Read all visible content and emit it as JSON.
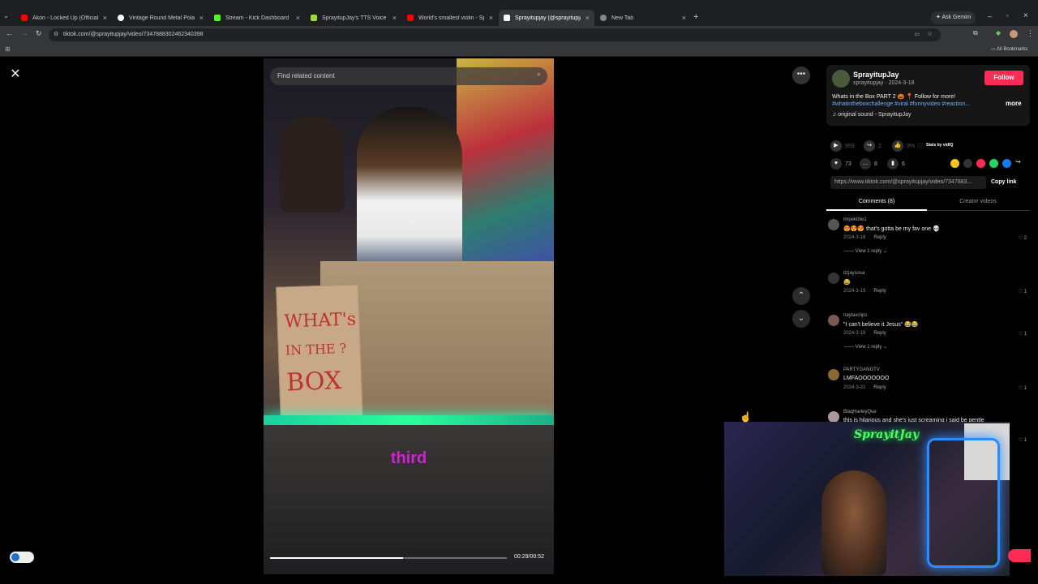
{
  "browser": {
    "tabs": [
      {
        "title": "Akon - Locked Up (Official Mu",
        "color": "#ff0000"
      },
      {
        "title": "Vintage Round Metal Polarized",
        "color": "#ffffff"
      },
      {
        "title": "Stream - Kick Dashboard",
        "color": "#53fc18"
      },
      {
        "title": "SprayitupJay's TTS Voice List | K",
        "color": "#9adf2e"
      },
      {
        "title": "World's smallest violin - Spong",
        "color": "#ff0000"
      },
      {
        "title": "Sprayitupjay (@sprayitupja",
        "color": "#ffffff"
      },
      {
        "title": "New Tab",
        "color": "#888888"
      }
    ],
    "ask_gemini": "Ask Gemini",
    "url": "tiktok.com/@sprayitupjay/video/7347888302462340398",
    "all_bookmarks": "All Bookmarks"
  },
  "video": {
    "search_placeholder": "Find related content",
    "caption": "third",
    "time": "00:29/00:52",
    "progress": 0.56,
    "sign_words": [
      "WHAT's",
      "IN THE ?",
      "BOX"
    ]
  },
  "creator": {
    "name": "SprayitupJay",
    "handle_date": "sprayitupjay · 2024-3-18",
    "follow": "Follow",
    "description": "Whats in the Box PART 2 🎃 📍 Follow for more!",
    "hashtags": "#whatintheboxchallenge #viral #funnyvideo #reaction...",
    "more": "more",
    "sound": "original sound - SprayitupJay"
  },
  "stats": {
    "views": "969",
    "shares": "2",
    "likes_pct": "9%",
    "stats_by": "Stats by vidIQ",
    "likes": "73",
    "comments": "8",
    "saves": "6"
  },
  "link": {
    "url": "https://www.tiktok.com/@sprayitupjay/video/7347883...",
    "copy": "Copy link"
  },
  "panel_tabs": {
    "comments": "Comments (8)",
    "creator_videos": "Creator videos"
  },
  "comments": [
    {
      "user": "impekible1",
      "text": "😍😍😍 that's gotta be my fav one 💀",
      "date": "2024-3-18",
      "reply": "Reply",
      "likes": "2",
      "view": "View 1 reply"
    },
    {
      "user": "itzjaysosa",
      "text": "😂",
      "date": "2024-3-19",
      "reply": "Reply",
      "likes": "1",
      "view": ""
    },
    {
      "user": "naylaxclips",
      "text": "\"I can't believe it Jesus\" 😂😂",
      "date": "2024-3-19",
      "reply": "Reply",
      "likes": "1",
      "view": "View 1 reply"
    },
    {
      "user": "PARTYGANGTV",
      "text": "LMFAOOOOOOO",
      "date": "2024-3-21",
      "reply": "Reply",
      "likes": "1",
      "view": ""
    },
    {
      "user": "BlaqHarleyQue",
      "text": "this is hilarious and she's just screaming i said be gentle",
      "date": "",
      "reply": "",
      "likes": "1",
      "view": ""
    }
  ],
  "webcam": {
    "neon_sign": "SprayitJay"
  },
  "colors": {
    "accent": "#fe2c55",
    "hashtag": "#6fb0ff"
  }
}
